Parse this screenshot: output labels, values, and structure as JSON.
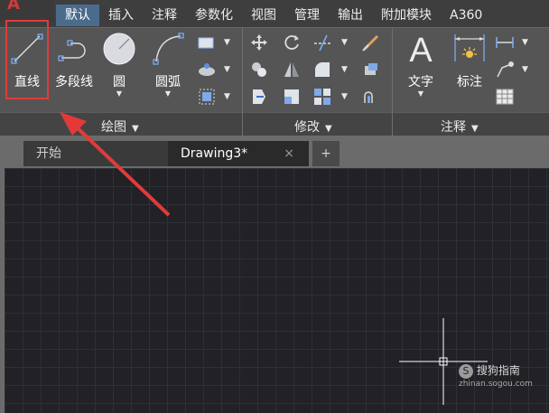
{
  "ribbon_tabs": [
    "默认",
    "插入",
    "注释",
    "参数化",
    "视图",
    "管理",
    "输出",
    "附加模块",
    "A360"
  ],
  "draw_panel": {
    "line": "直线",
    "polyline": "多段线",
    "circle": "圆",
    "arc": "圆弧",
    "title": "绘图"
  },
  "modify_panel": {
    "title": "修改"
  },
  "annotation_panel": {
    "text": "文字",
    "dimension": "标注",
    "title": "注释"
  },
  "doc_tabs": {
    "start": "开始",
    "drawing": "Drawing3*",
    "close": "×",
    "new": "+"
  },
  "watermark": {
    "brand": "搜狗指南",
    "url": "zhinan.sogou.com"
  },
  "colors": {
    "accent_tab": "#4a6b8c",
    "highlight": "#e23a3a",
    "canvas": "#212126"
  }
}
